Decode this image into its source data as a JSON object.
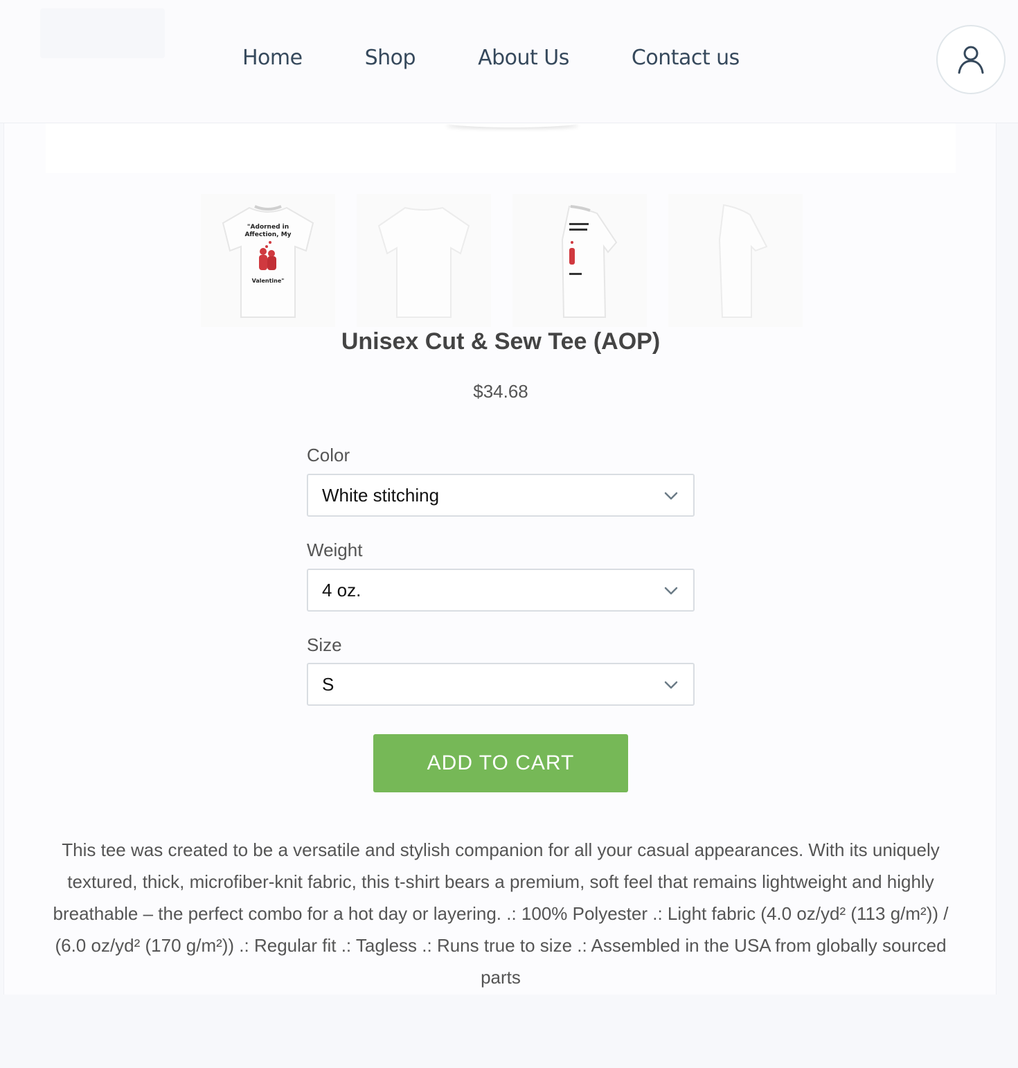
{
  "nav": {
    "items": [
      {
        "label": "Home"
      },
      {
        "label": "Shop"
      },
      {
        "label": "About Us"
      },
      {
        "label": "Contact us"
      }
    ],
    "account_icon": "user-icon"
  },
  "product": {
    "thumbnails": [
      {
        "print_lines": [
          "\"Adorned in",
          "Affection, My",
          "Valentine\""
        ]
      },
      {
        "print_lines": []
      },
      {
        "print_lines": []
      },
      {
        "print_lines": []
      }
    ],
    "title": "Unisex Cut & Sew Tee (AOP)",
    "price": "$34.68",
    "options": {
      "color": {
        "label": "Color",
        "selected": "White stitching"
      },
      "weight": {
        "label": "Weight",
        "selected": "4 oz."
      },
      "size": {
        "label": "Size",
        "selected": "S"
      }
    },
    "add_to_cart": "ADD TO CART",
    "description": "This tee was created to be a versatile and stylish companion for all your casual appearances. With its uniquely textured, thick, microfiber-knit fabric, this t-shirt bears a premium, soft feel that remains lightweight and highly breathable – the perfect combo for a hot day or layering. .: 100% Polyester .: Light fabric (4.0 oz/yd² (113 g/m²)) / (6.0 oz/yd² (170 g/m²)) .: Regular fit .: Tagless .: Runs true to size .: Assembled in the USA from globally sourced parts"
  },
  "colors": {
    "nav_text": "#36495c",
    "cart_button": "#76b857",
    "print_red": "#d0393f"
  }
}
